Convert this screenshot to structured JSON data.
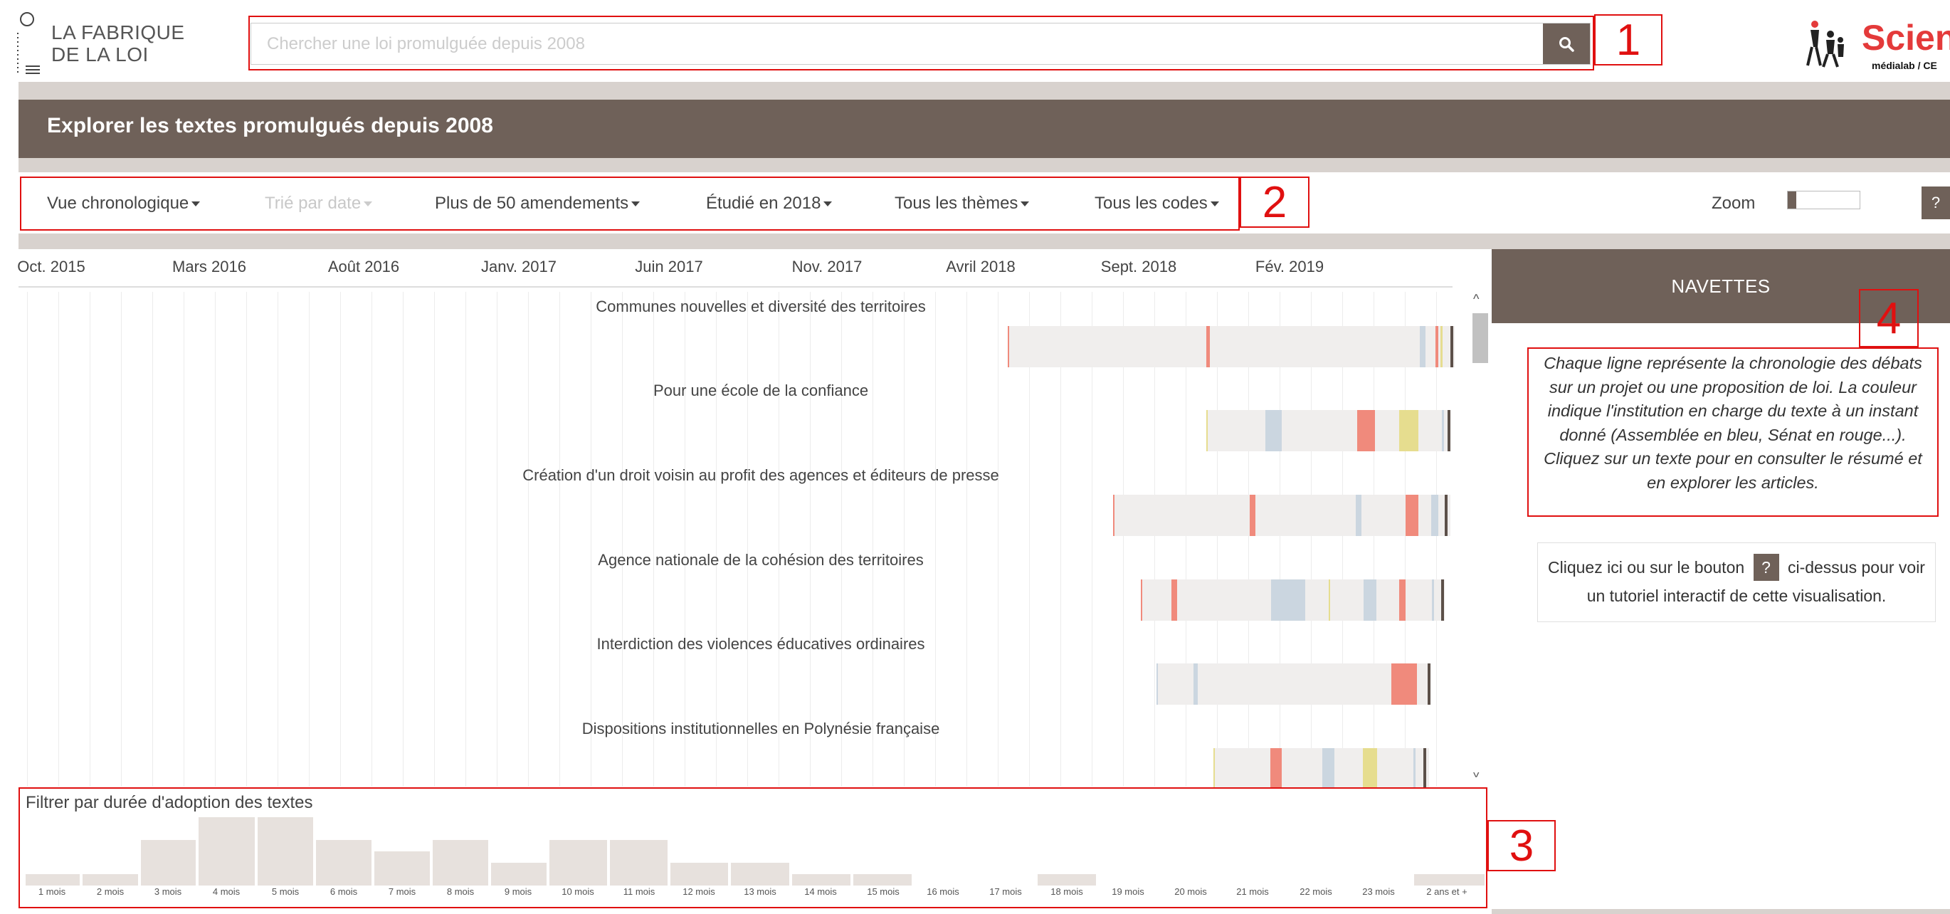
{
  "header": {
    "logo_line1": "LA FABRIQUE",
    "logo_line2": "DE LA LOI",
    "search_placeholder": "Chercher une loi promulguée depuis 2008",
    "search_icon": "search-icon",
    "partner_name": "Scienc",
    "partner_sub": "médialab / CE"
  },
  "page": {
    "title": "Explorer les textes promulgués depuis 2008"
  },
  "filters": {
    "view": "Vue chronologique",
    "sort": "Trié par date",
    "amendments": "Plus de 50 amendements",
    "year": "Étudié en 2018",
    "themes": "Tous les thèmes",
    "codes": "Tous les codes",
    "zoom_label": "Zoom",
    "zoom_level": 0.1,
    "help_label": "?"
  },
  "timeline": {
    "months": [
      "Oct. 2015",
      "Mars 2016",
      "Août 2016",
      "Janv. 2017",
      "Juin 2017",
      "Nov. 2017",
      "Avril 2018",
      "Sept. 2018",
      "Fév. 2019"
    ],
    "texts": [
      {
        "title": "Communes nouvelles et diversité des territoires"
      },
      {
        "title": "Pour une école de la confiance"
      },
      {
        "title": "Création d'un droit voisin au profit des agences et éditeurs de presse"
      },
      {
        "title": "Agence nationale de la cohésion des territoires"
      },
      {
        "title": "Interdiction des violences éducatives ordinaires"
      },
      {
        "title": "Dispositions institutionnelles en Polynésie française"
      }
    ]
  },
  "colors": {
    "brand": "#6f6159",
    "assemblee": "#cbd6e0",
    "senat_soft": "#f79c8f",
    "senat": "#f08a7c",
    "cmp": "#e6dd8f",
    "promulgation": "#5c5049",
    "annotation": "#e01010"
  },
  "navettes": {
    "header": "NAVETTES",
    "description": "Chaque ligne représente la chronologie des débats sur un projet ou une proposition de loi. La couleur indique l'institution en charge du texte à un instant donné (Assemblée en bleu, Sénat en rouge...). Cliquez sur un texte pour en consulter le résumé et en explorer les articles.",
    "tutorial_before": "Cliquez ici ou sur le bouton",
    "tutorial_button": "?",
    "tutorial_after": "ci-dessus pour voir un tutoriel interactif de cette visualisation."
  },
  "histogram": {
    "title": "Filtrer par durée d'adoption des textes",
    "labels": [
      "1 mois",
      "2 mois",
      "3 mois",
      "4 mois",
      "5 mois",
      "6 mois",
      "7 mois",
      "8 mois",
      "9 mois",
      "10 mois",
      "11 mois",
      "12 mois",
      "13 mois",
      "14 mois",
      "15 mois",
      "16 mois",
      "17 mois",
      "18 mois",
      "19 mois",
      "20 mois",
      "21 mois",
      "22 mois",
      "23 mois",
      "2 ans et +"
    ],
    "values": [
      1,
      1,
      4,
      6,
      6,
      4,
      3,
      4,
      2,
      4,
      4,
      2,
      2,
      1,
      1,
      0,
      0,
      1,
      0,
      0,
      0,
      0,
      0,
      1
    ]
  },
  "annotations": [
    "1",
    "2",
    "3",
    "4"
  ]
}
